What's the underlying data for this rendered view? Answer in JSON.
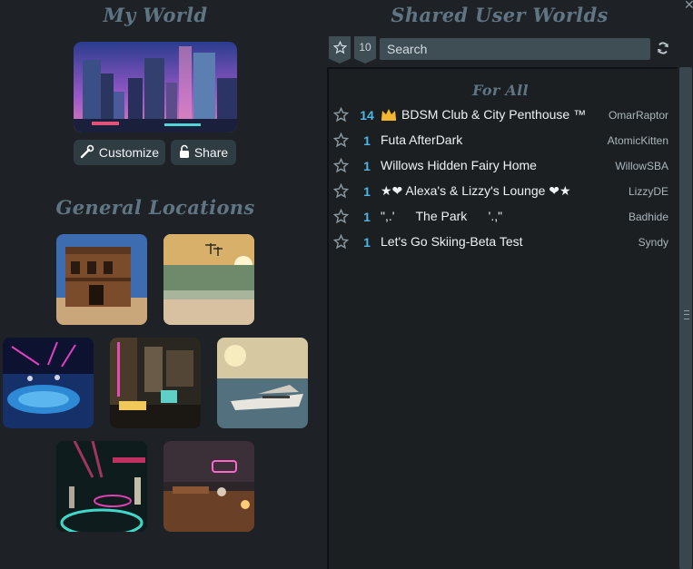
{
  "my_world": {
    "title": "My World",
    "customize_label": "Customize",
    "share_label": "Share"
  },
  "shared": {
    "title": "Shared User Worlds",
    "count_filter": "10",
    "search_placeholder": "Search",
    "group_title": "For All",
    "worlds": [
      {
        "count": "14",
        "name": "BDSM Club & City Penthouse ™",
        "owner": "OmarRaptor",
        "crown": true
      },
      {
        "count": "1",
        "name": "Futa AfterDark",
        "owner": "AtomicKitten"
      },
      {
        "count": "1",
        "name": "Willows Hidden Fairy Home",
        "owner": "WillowSBA"
      },
      {
        "count": "1",
        "name": "★❤ Alexa's & Lizzy's Lounge ❤★",
        "owner": "LizzyDE"
      },
      {
        "count": "1",
        "name": "\",.'      The Park      '.,\"",
        "owner": "Badhide"
      },
      {
        "count": "1",
        "name": "Let's Go Skiing-Beta Test",
        "owner": "Syndy"
      }
    ]
  },
  "locations": {
    "title": "General Locations",
    "items": [
      "saloon",
      "beach",
      "nightclub-pool",
      "lounge-bar",
      "yacht",
      "dance-club",
      "pub"
    ]
  },
  "icons": {
    "favorite": "star-outline-icon",
    "refresh": "refresh-icon",
    "customize": "wrench-icon",
    "share": "unlock-icon",
    "top_world": "crown-icon",
    "close": "close-icon"
  },
  "colors": {
    "background": "#1e2226",
    "accent_count": "#4fb6e6",
    "heading": "#5f7583",
    "crown": "#f2b632"
  }
}
